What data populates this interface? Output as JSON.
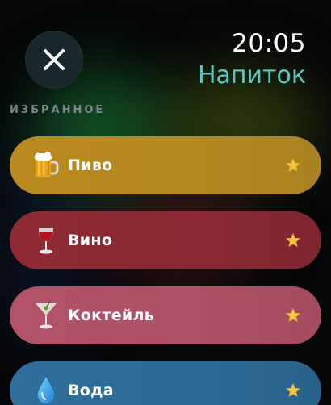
{
  "header": {
    "time": "20:05",
    "title": "Напиток"
  },
  "section": {
    "label": "ИЗБРАННОЕ"
  },
  "items": [
    {
      "label": "Пиво",
      "icon": "beer-mug-icon",
      "color": "#b98a1f",
      "favorite": true
    },
    {
      "label": "Вино",
      "icon": "wine-glass-icon",
      "color": "#8e2a34",
      "favorite": true
    },
    {
      "label": "Коктейль",
      "icon": "cocktail-glass-icon",
      "color": "#b25268",
      "favorite": true
    },
    {
      "label": "Вода",
      "icon": "water-drop-icon",
      "color": "#2f6f9a",
      "favorite": true
    }
  ],
  "colors": {
    "accent": "#5fc6bf",
    "section_label": "#7a8687",
    "close_button_bg": "#17272b",
    "star": "#f4c542"
  }
}
